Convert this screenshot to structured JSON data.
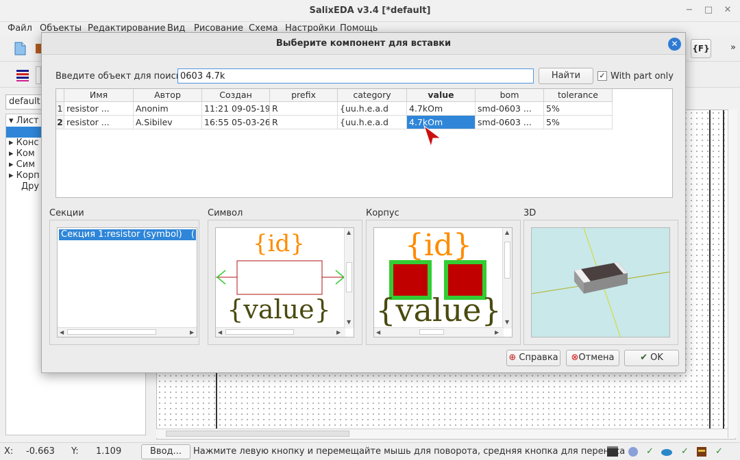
{
  "window": {
    "title": "SalixEDA v3.4 [*default]",
    "min_label": "−",
    "max_label": "□",
    "close_label": "✕"
  },
  "menu": [
    "Файл",
    "Объекты",
    "Редактирование",
    "Вид",
    "Рисование",
    "Схема",
    "Настройки",
    "Помощь"
  ],
  "toolbar": {
    "f_icon_label": "{F}",
    "overflow": "»"
  },
  "left_panel": {
    "combo_value": "default",
    "tree_items": [
      "Лист",
      "Конс",
      "Ком",
      "Сим",
      "Корп",
      "Дру"
    ]
  },
  "dialog": {
    "title": "Выберите компонент для вставки",
    "search_label": "Введите объект для поиска:",
    "search_value": "0603 4.7k",
    "find_button": "Найти",
    "part_only_label": "With part only",
    "part_only_checked": true,
    "check_mark": "✓",
    "table": {
      "headers": [
        "Имя",
        "Автор",
        "Создан",
        "prefix",
        "category",
        "value",
        "bom",
        "tolerance"
      ],
      "sorted_column": "value",
      "rows": [
        {
          "num": "1",
          "name": "resistor ...",
          "author": "Anonim",
          "created": "11:21 09-05-19",
          "prefix": "R",
          "category": "{uu.h.e.a.d",
          "value": "4.7kOm",
          "bom": "smd-0603 ...",
          "tolerance": "5%"
        },
        {
          "num": "2",
          "name": "resistor ...",
          "author": "A.Sibilev",
          "created": "16:55 05-03-26",
          "prefix": "R",
          "category": "{uu.h.e.a.d",
          "value": "4.7kOm",
          "bom": "smd-0603 ...",
          "tolerance": "5%"
        }
      ]
    },
    "sections": {
      "sections_label": "Секции",
      "symbol_label": "Символ",
      "package_label": "Корпус",
      "3d_label": "3D",
      "section_item": "Секция 1:resistor (symbol)",
      "section_item_tail": "("
    },
    "symbol_preview": {
      "id_text": "{id}",
      "value_text": "{value}"
    },
    "package_preview": {
      "id_text": "{id}",
      "value_text": "{value}"
    },
    "help_button": "Справка",
    "cancel_button": "Отмена",
    "ok_button": "OK"
  },
  "status": {
    "x_label": "X:",
    "x_value": "-0.663",
    "y_label": "Y:",
    "y_value": "1.109",
    "input_button": "Ввод...",
    "message": "Нажмите левую кнопку и перемещайте мышь для поворота, средняя кнопка для переноса",
    "check": "✓"
  },
  "colors": {
    "accent": "#2f86d8",
    "symbol_orange": "#ff8c00",
    "symbol_olive": "#4a4a10",
    "pad_red": "#c00000",
    "pad_green": "#33cc33",
    "3d_bg": "#c8e8ea"
  }
}
